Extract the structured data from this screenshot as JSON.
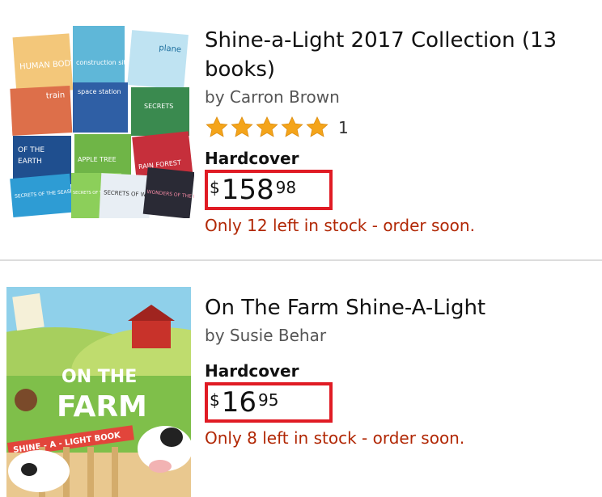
{
  "results": [
    {
      "title": "Shine-a-Light 2017 Collection (13 books)",
      "author": "by Carron Brown",
      "rating": 5,
      "rating_count": "1",
      "format": "Hardcover",
      "price": {
        "symbol": "$",
        "whole": "158",
        "fraction": "98"
      },
      "stock": "Only 12 left in stock - order soon.",
      "cover_labels": [
        "HUMAN BODY",
        "construction site",
        "plane",
        "train",
        "space station",
        "SECRETS",
        "OF THE",
        "EARTH",
        "APPLE TREE",
        "RAIN FOREST",
        "SECRETS OF THE SEASHORE",
        "SECRETS OF THE VEGETABLE GARDEN",
        "SECRETS OF WINTER",
        "WONDERS OF THE USA"
      ]
    },
    {
      "title": "On The Farm Shine-A-Light",
      "author": "by Susie Behar",
      "format": "Hardcover",
      "price": {
        "symbol": "$",
        "whole": "16",
        "fraction": "95"
      },
      "stock": "Only 8 left in stock - order soon.",
      "cover_labels": [
        "ON THE",
        "FARM",
        "SHINE - A - LIGHT BOOK"
      ]
    }
  ],
  "colors": {
    "star": "#f4a41a",
    "stock": "#b12704",
    "highlight_box": "#e01b24"
  }
}
